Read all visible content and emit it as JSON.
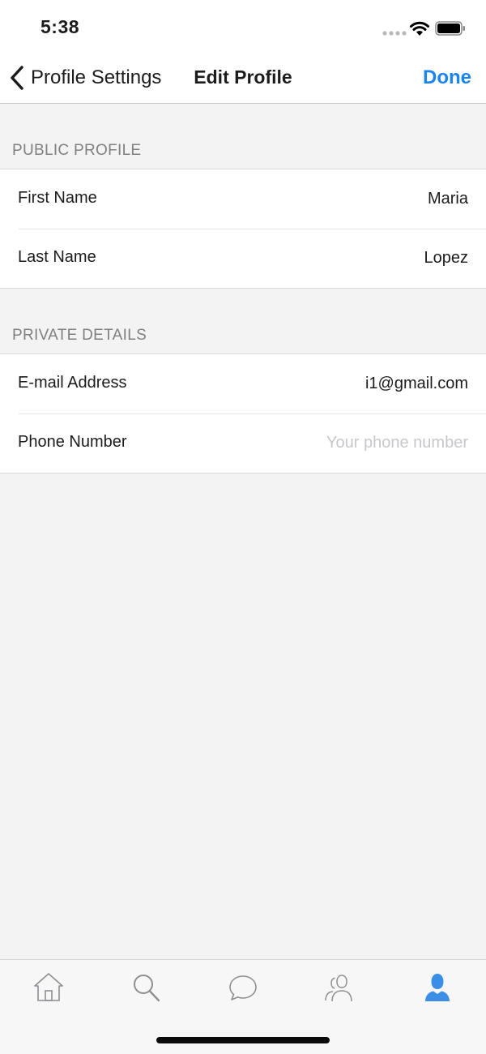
{
  "status_bar": {
    "time": "5:38",
    "signal_icon": "signal-dots-icon",
    "wifi_icon": "wifi-icon",
    "battery_icon": "battery-icon"
  },
  "nav": {
    "back_label": "Profile Settings",
    "title": "Edit Profile",
    "done_label": "Done",
    "accent_color": "#1a84f0"
  },
  "public_profile": {
    "header": "PUBLIC PROFILE",
    "first_name_label": "First Name",
    "first_name_value": "Maria",
    "last_name_label": "Last Name",
    "last_name_value": "Lopez"
  },
  "private_details": {
    "header": "PRIVATE DETAILS",
    "email_label": "E-mail Address",
    "email_value": "i1@gmail.com",
    "phone_label": "Phone Number",
    "phone_value": "",
    "phone_placeholder": "Your phone number"
  },
  "tab_bar": {
    "tabs": [
      {
        "icon": "home-icon",
        "active": false
      },
      {
        "icon": "search-icon",
        "active": false
      },
      {
        "icon": "chat-bubble-icon",
        "active": false
      },
      {
        "icon": "people-icon",
        "active": false
      },
      {
        "icon": "profile-icon",
        "active": true
      }
    ],
    "active_color": "#3a8ee6",
    "inactive_color": "#8e8e93"
  }
}
